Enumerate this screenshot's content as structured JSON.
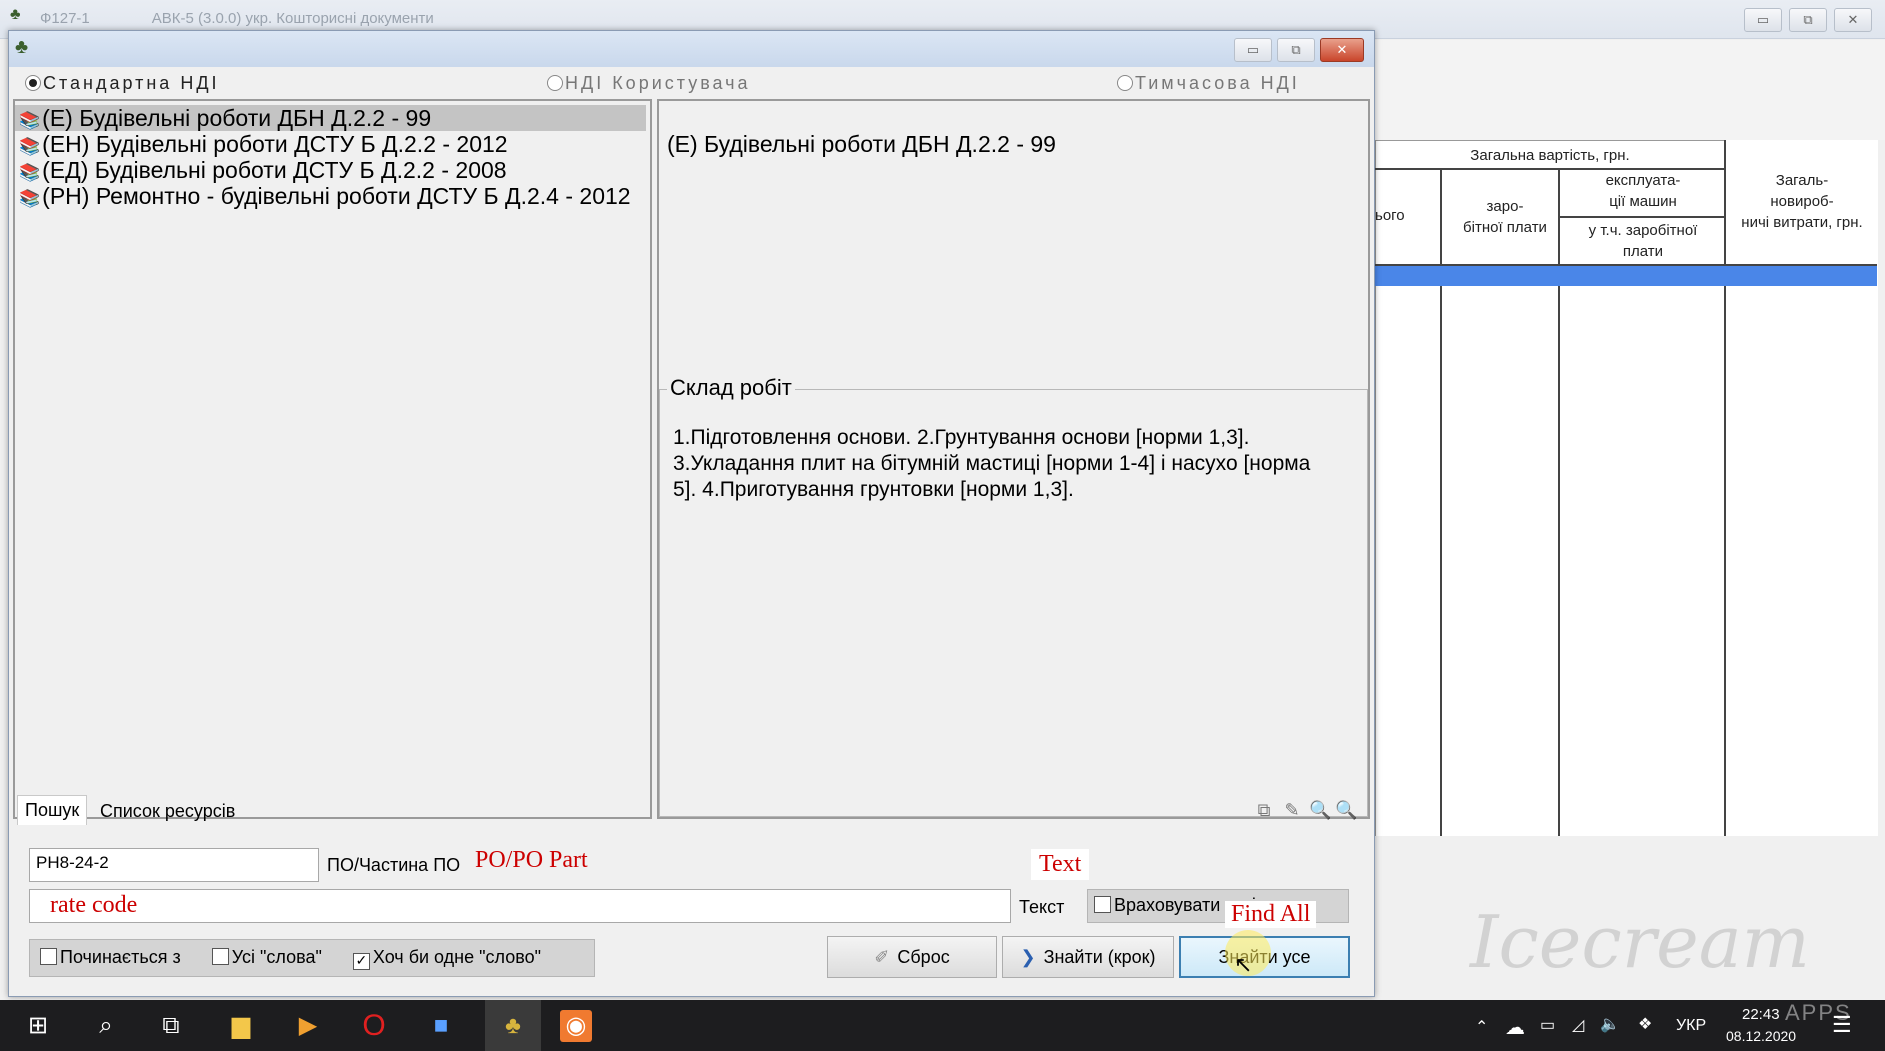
{
  "main_window": {
    "title_code": "Ф127-1",
    "title_app": "АВК-5 (3.0.0) укр. Кошторисні документи",
    "controls": {
      "minimize": "▭",
      "restore": "⧉",
      "close": "✕"
    }
  },
  "background_table": {
    "header_total": "Загальна вартість, грн.",
    "col_vsogo": "ього",
    "col_wages": "заро-\nбітної плати",
    "col_machines": "експлуата-\nції машин",
    "col_machines_wages": "у т.ч. заробітної\nплати",
    "col_overhead": "Загаль-\nновироб-\nничі витрати, грн."
  },
  "dialog": {
    "radios": {
      "standard": "Стандартна НДІ",
      "user": "НДІ Користувача",
      "temporary": "Тимчасова НДІ"
    },
    "tree": [
      {
        "label": "(Е) Будівельні роботи ДБН  Д.2.2 - 99"
      },
      {
        "label": "(ЕН) Будівельні роботи ДСТУ Б Д.2.2 - 2012"
      },
      {
        "label": "(ЕД) Будівельні роботи ДСТУ Б Д.2.2 - 2008"
      },
      {
        "label": "(РН) Ремонтно - будівельні роботи ДСТУ Б Д.2.4 - 2012"
      }
    ],
    "detail_title": "(Е) Будівельні роботи ДБН  Д.2.2 - 99",
    "composition_legend": "Склад робіт",
    "composition_text": "1.Підготовлення основи. 2.Грунтування основи [норми 1,3]. 3.Укладання плит на бітумній мастиці [норми 1-4] і насухо [норма 5]. 4.Приготування грунтовки [норми 1,3].",
    "tabs": [
      "Пошук",
      "Список ресурсів"
    ],
    "search": {
      "po_value": "РН8-24-2",
      "po_label": "ПО/Частина ПО",
      "po_annotation": "PO/PO Part",
      "text_annotation": "Text",
      "rate_code_annotation": "rate code",
      "text_label": "Текст",
      "case_label": "Враховувати регістр",
      "starts_with": "Починається з",
      "all_words": "Усі \"слова\"",
      "any_word": "Хоч би одне \"слово\"",
      "find_all_annotation": "Find All"
    },
    "buttons": {
      "reset": "Сброс",
      "find_step": "Знайти (крок)",
      "find_all": "Знайти усе"
    }
  },
  "taskbar": {
    "lang": "УКР",
    "time": "22:43",
    "date": "08.12.2020"
  },
  "watermark": {
    "text": "Icecream",
    "sub": "APPS"
  }
}
